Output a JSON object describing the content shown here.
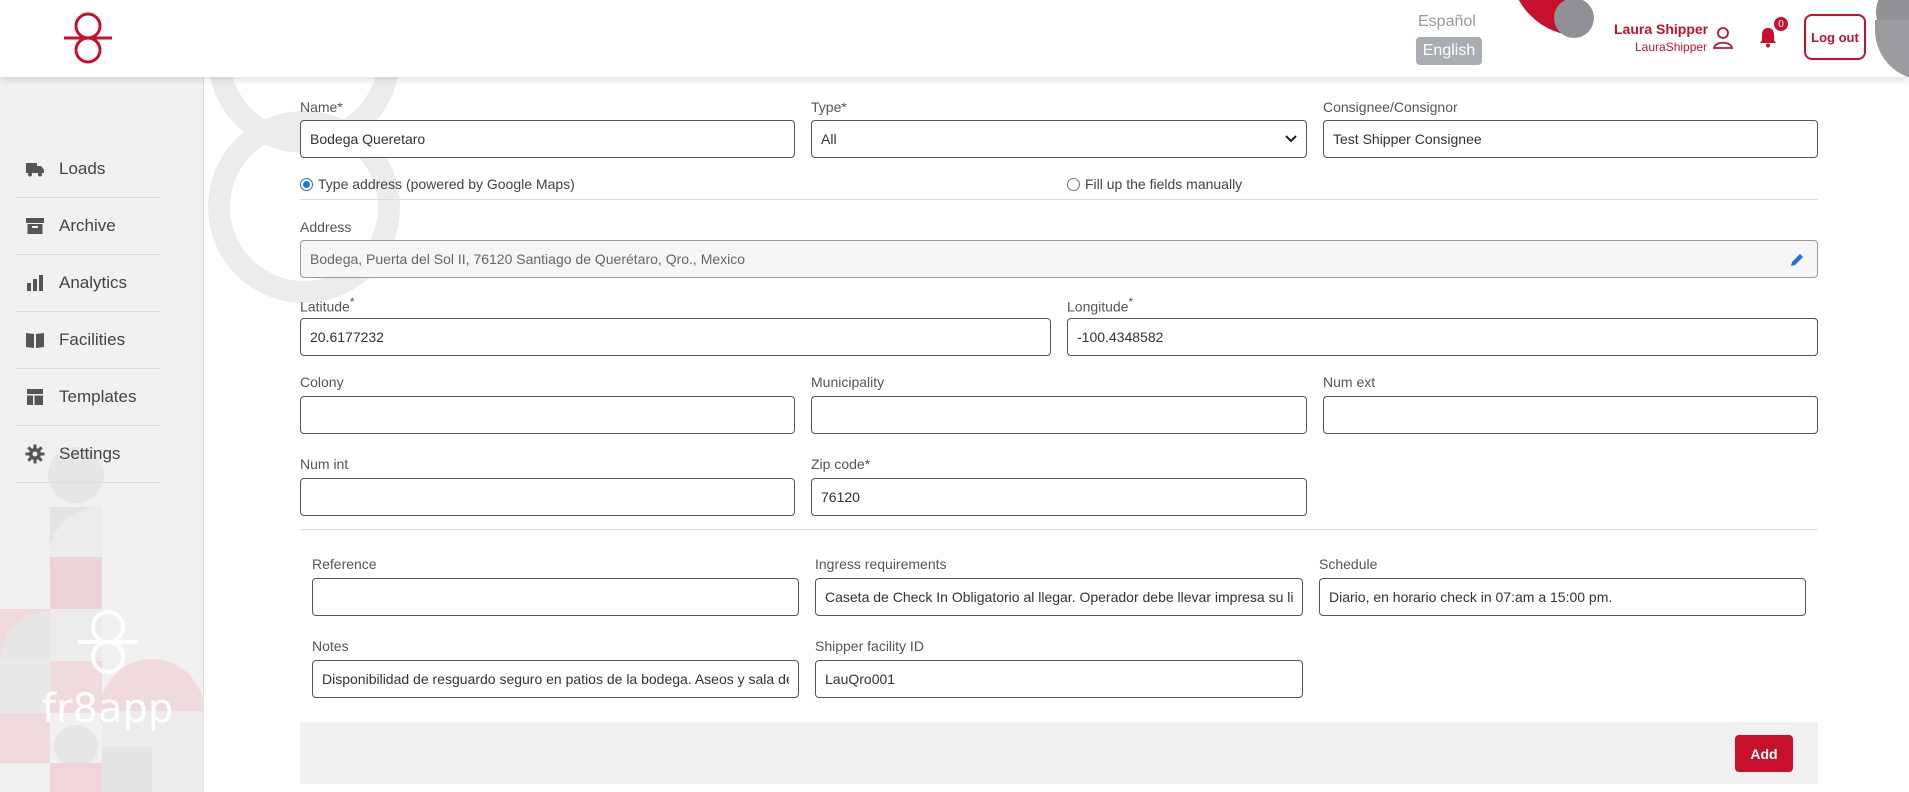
{
  "header": {
    "lang_inactive": "Español",
    "lang_active": "English",
    "user_name": "Laura Shipper",
    "user_login": "LauraShipper",
    "notifications_count": "0",
    "logout_label": "Log out"
  },
  "sidebar": {
    "items": [
      {
        "label": "Loads",
        "icon": "truck-icon"
      },
      {
        "label": "Archive",
        "icon": "archive-box-icon"
      },
      {
        "label": "Analytics",
        "icon": "bar-chart-icon"
      },
      {
        "label": "Facilities",
        "icon": "book-open-icon"
      },
      {
        "label": "Templates",
        "icon": "layout-template-icon"
      },
      {
        "label": "Settings",
        "icon": "gear-icon"
      }
    ],
    "brand_text": "fr8app"
  },
  "form": {
    "name": {
      "label": "Name*",
      "value": "Bodega Queretaro"
    },
    "type": {
      "label": "Type*",
      "value": "All"
    },
    "consignee": {
      "label": "Consignee/Consignor",
      "value": "Test Shipper Consignee"
    },
    "radio_google": "Type address (powered by Google Maps)",
    "radio_manual": "Fill up the fields manually",
    "address": {
      "label": "Address",
      "value": "Bodega, Puerta del Sol II, 76120 Santiago de Querétaro, Qro., Mexico"
    },
    "latitude": {
      "label": "Latitude",
      "value": "20.6177232"
    },
    "longitude": {
      "label": "Longitude",
      "value": "-100.4348582"
    },
    "required_mark": "*",
    "colony": {
      "label": "Colony",
      "value": ""
    },
    "municipality": {
      "label": "Municipality",
      "value": ""
    },
    "num_ext": {
      "label": "Num ext",
      "value": ""
    },
    "num_int": {
      "label": "Num int",
      "value": ""
    },
    "zip": {
      "label": "Zip code*",
      "value": "76120"
    },
    "reference": {
      "label": "Reference",
      "value": ""
    },
    "ingress": {
      "label": "Ingress requirements",
      "value": "Caseta de Check In Obligatorio al llegar. Operador debe llevar impresa su li"
    },
    "schedule": {
      "label": "Schedule",
      "value": "Diario, en horario check in 07:am a 15:00 pm."
    },
    "notes": {
      "label": "Notes",
      "value": "Disponibilidad de resguardo seguro en patios de la bodega. Aseos y sala de"
    },
    "facility_id": {
      "label": "Shipper facility ID",
      "value": "LauQro001"
    },
    "add_label": "Add"
  },
  "colors": {
    "brand_red": "#c8102e",
    "radio_blue": "#1a73e8",
    "sidebar_bg": "#f1f1f1"
  }
}
